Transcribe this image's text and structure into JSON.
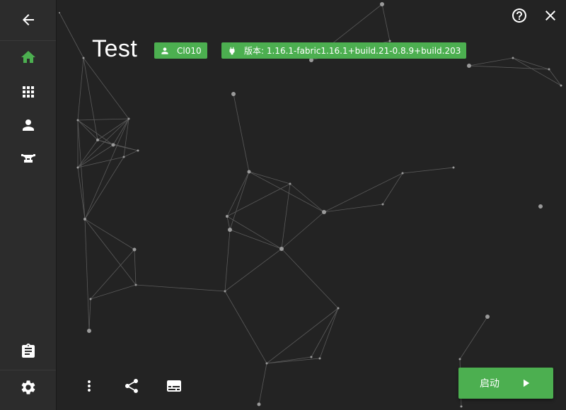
{
  "colors": {
    "accent": "#4caf50",
    "background": "#232323",
    "sidebar": "#2c2c2c",
    "icon": "#ffffff"
  },
  "sidebar": {
    "items": [
      {
        "icon": "back-arrow-icon"
      },
      {
        "icon": "home-icon",
        "active": true
      },
      {
        "icon": "grid-icon"
      },
      {
        "icon": "account-icon"
      },
      {
        "icon": "anvil-icon"
      },
      {
        "icon": "clipboard-icon"
      },
      {
        "icon": "settings-icon"
      }
    ]
  },
  "header": {
    "title": "Test",
    "player_badge": "Cl010",
    "version_badge": "版本: 1.16.1-fabric1.16.1+build.21-0.8.9+build.203"
  },
  "top_right": {
    "icons": [
      "help-icon",
      "close-icon"
    ]
  },
  "bottom_bar": {
    "icons": [
      "more-vert-icon",
      "share-icon",
      "subtitles-icon"
    ],
    "launch_label": "启动"
  }
}
